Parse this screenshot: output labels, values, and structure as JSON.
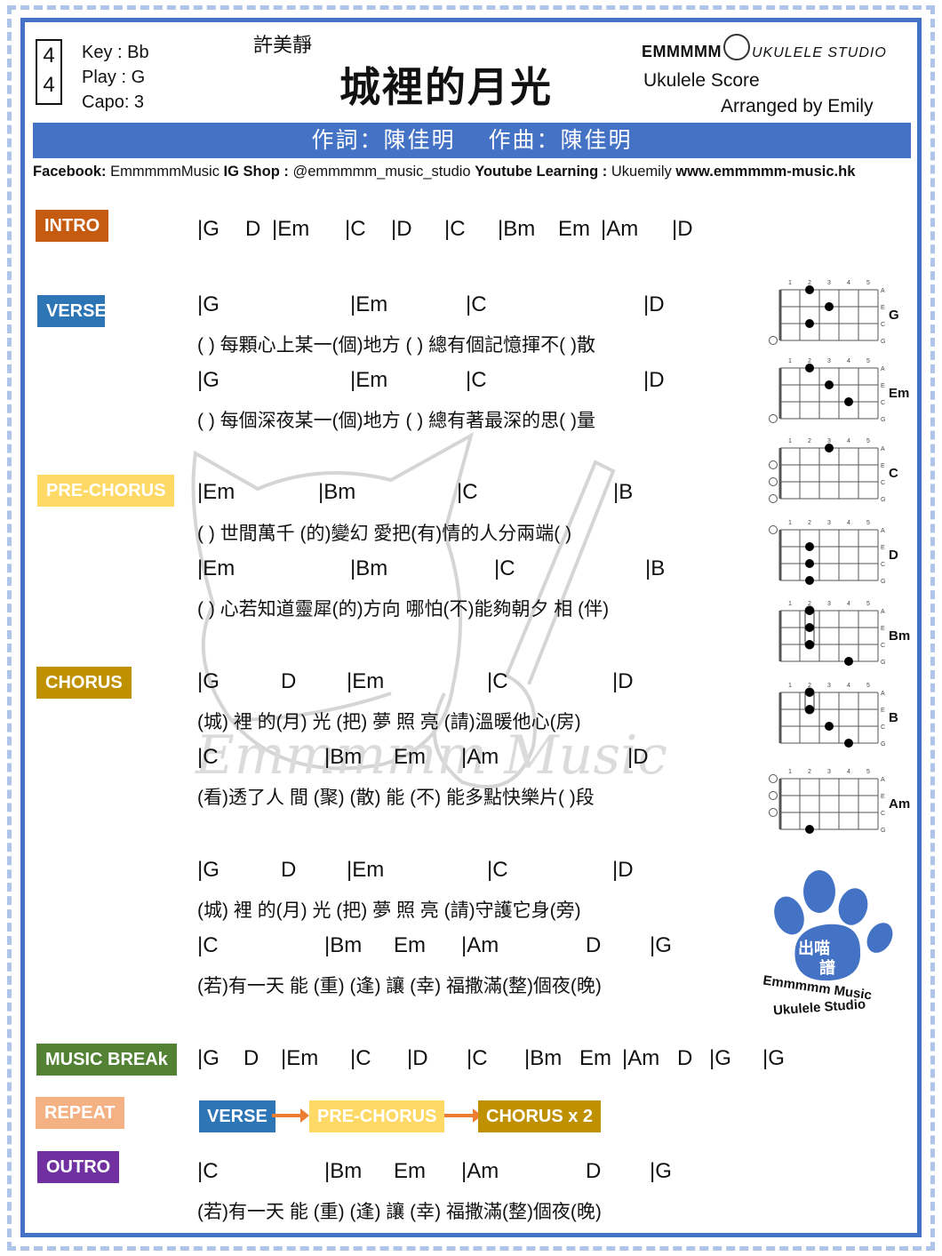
{
  "header": {
    "time_signature": {
      "top": "4",
      "bottom": "4"
    },
    "key": "Key : Bb",
    "play": "Play : G",
    "capo": "Capo: 3",
    "artist": "許美靜",
    "title": "城裡的月光",
    "brand_main": "EMMMMM",
    "brand_studio": "UKULELE STUDIO",
    "score_label": "Ukulele Score",
    "arranger": "Arranged by Emily"
  },
  "credits": {
    "lyricist": "作詞：陳佳明",
    "composer": "作曲：陳佳明"
  },
  "social": {
    "facebook_label": "Facebook:",
    "facebook_value": "EmmmmmMusic",
    "ig_label": "IG Shop :",
    "ig_value": "@emmmmm_music_studio",
    "youtube_label": "Youtube Learning :",
    "youtube_value": "Ukuemily",
    "website": "www.emmmmm-music.hk"
  },
  "colors": {
    "frame": "#4472c4",
    "intro": "#c55a11",
    "verse": "#2e75b6",
    "pre_chorus": "#ffd966",
    "chorus": "#bf9000",
    "music_break": "#548235",
    "repeat": "#f4b183",
    "outro": "#7030a0",
    "arrow": "#ed7d31"
  },
  "sections": {
    "intro": {
      "tag": "INTRO",
      "lines": [
        {
          "chords": [
            {
              "t": "|G"
            },
            {
              "t": "D"
            },
            {
              "t": "|Em"
            },
            {
              "t": "|C"
            },
            {
              "t": "|D"
            },
            {
              "t": "|C"
            },
            {
              "t": "|Bm"
            },
            {
              "t": "Em"
            },
            {
              "t": "|Am"
            },
            {
              "t": "|D"
            }
          ]
        }
      ]
    },
    "verse": {
      "tag": "VERSE",
      "lines": [
        {
          "chords": [
            {
              "t": "|G"
            },
            {
              "t": "|Em"
            },
            {
              "t": "|C"
            },
            {
              "t": "|D"
            }
          ],
          "lyric": "( ) 每顆心上某一(個)地方     ( ) 總有個記憶揮不( )散"
        },
        {
          "chords": [
            {
              "t": "|G"
            },
            {
              "t": "|Em"
            },
            {
              "t": "|C"
            },
            {
              "t": "|D"
            }
          ],
          "lyric": "( ) 每個深夜某一(個)地方     ( ) 總有著最深的思( )量"
        }
      ]
    },
    "pre_chorus": {
      "tag": "PRE-CHORUS",
      "lines": [
        {
          "chords": [
            {
              "t": "|Em"
            },
            {
              "t": "|Bm"
            },
            {
              "t": "|C"
            },
            {
              "t": "|B"
            }
          ],
          "lyric": "( ) 世間萬千 (的)變幻   愛把(有)情的人分兩端( )"
        },
        {
          "chords": [
            {
              "t": "|Em"
            },
            {
              "t": "|Bm"
            },
            {
              "t": "|C"
            },
            {
              "t": "|B"
            }
          ],
          "lyric": "( ) 心若知道靈犀(的)方向   哪怕(不)能夠朝夕 相 (伴)"
        }
      ]
    },
    "chorus": {
      "tag": "CHORUS",
      "lines": [
        {
          "chords": [
            {
              "t": "|G"
            },
            {
              "t": "D"
            },
            {
              "t": "|Em"
            },
            {
              "t": "|C"
            },
            {
              "t": "|D"
            }
          ],
          "lyric": "(城) 裡 的(月) 光 (把) 夢 照 亮    (請)溫暖他心(房)"
        },
        {
          "chords": [
            {
              "t": "|C"
            },
            {
              "t": "|Bm"
            },
            {
              "t": "Em"
            },
            {
              "t": "|Am"
            },
            {
              "t": "|D"
            }
          ],
          "lyric": "(看)透了人 間 (聚)    (散)  能  (不) 能多點快樂片( )段"
        },
        {
          "chords": [
            {
              "t": "|G"
            },
            {
              "t": "D"
            },
            {
              "t": "|Em"
            },
            {
              "t": "|C"
            },
            {
              "t": "|D"
            }
          ],
          "lyric": "(城) 裡 的(月) 光 (把) 夢 照 亮    (請)守護它身(旁)"
        },
        {
          "chords": [
            {
              "t": "|C"
            },
            {
              "t": "|Bm"
            },
            {
              "t": "Em"
            },
            {
              "t": "|Am"
            },
            {
              "t": "D"
            },
            {
              "t": "|G"
            }
          ],
          "lyric": "(若)有一天 能 (重)    (逢)   讓  (幸) 福撒滿(整)個夜(晚)"
        }
      ]
    },
    "music_break": {
      "tag": "MUSIC BREAk",
      "lines": [
        {
          "chords": [
            {
              "t": "|G"
            },
            {
              "t": "D"
            },
            {
              "t": "|Em"
            },
            {
              "t": "|C"
            },
            {
              "t": "|D"
            },
            {
              "t": "|C"
            },
            {
              "t": "|Bm"
            },
            {
              "t": "Em"
            },
            {
              "t": "|Am"
            },
            {
              "t": "D"
            },
            {
              "t": "|G"
            },
            {
              "t": "|G"
            }
          ]
        }
      ]
    },
    "repeat": {
      "tag": "REPEAT",
      "sequence": [
        "VERSE",
        "PRE-CHORUS",
        "CHORUS x 2"
      ]
    },
    "outro": {
      "tag": "OUTRO",
      "lines": [
        {
          "chords": [
            {
              "t": "|C"
            },
            {
              "t": "|Bm"
            },
            {
              "t": "Em"
            },
            {
              "t": "|Am"
            },
            {
              "t": "D"
            },
            {
              "t": "|G"
            }
          ],
          "lyric": "(若)有一天 能 (重)    (逢)   讓  (幸) 福撒滿(整)個夜(晚)"
        }
      ]
    }
  },
  "chord_diagrams": {
    "fret_numbers": [
      "1",
      "2",
      "3",
      "4",
      "5"
    ],
    "string_names": [
      "A",
      "E",
      "C",
      "G"
    ],
    "chords": [
      {
        "name": "G",
        "dots": [
          [
            0,
            2
          ],
          [
            1,
            3
          ],
          [
            2,
            2
          ]
        ],
        "open": [
          3
        ],
        "barre": null
      },
      {
        "name": "Em",
        "dots": [
          [
            0,
            2
          ],
          [
            1,
            3
          ],
          [
            2,
            4
          ]
        ],
        "open": [
          3
        ],
        "barre": null
      },
      {
        "name": "C",
        "dots": [
          [
            0,
            3
          ]
        ],
        "open": [
          1,
          2,
          3
        ],
        "barre": null
      },
      {
        "name": "D",
        "dots": [
          [
            1,
            2
          ],
          [
            2,
            2
          ],
          [
            3,
            2
          ]
        ],
        "open": [
          0
        ],
        "barre": null
      },
      {
        "name": "Bm",
        "dots": [
          [
            0,
            2
          ],
          [
            1,
            2
          ],
          [
            2,
            2
          ],
          [
            3,
            4
          ]
        ],
        "open": [],
        "barre": [
          0,
          2,
          2
        ]
      },
      {
        "name": "B",
        "dots": [
          [
            0,
            2
          ],
          [
            1,
            2
          ],
          [
            2,
            3
          ],
          [
            3,
            4
          ]
        ],
        "open": [],
        "barre": [
          0,
          1,
          2
        ]
      },
      {
        "name": "Am",
        "dots": [
          [
            3,
            2
          ]
        ],
        "open": [
          0,
          1,
          2
        ],
        "barre": null
      }
    ]
  },
  "stamp": {
    "paw_text_1": "出喵",
    "paw_text_2": "譜",
    "line1": "Emmmmm Music",
    "line2": "Ukulele Studio"
  }
}
